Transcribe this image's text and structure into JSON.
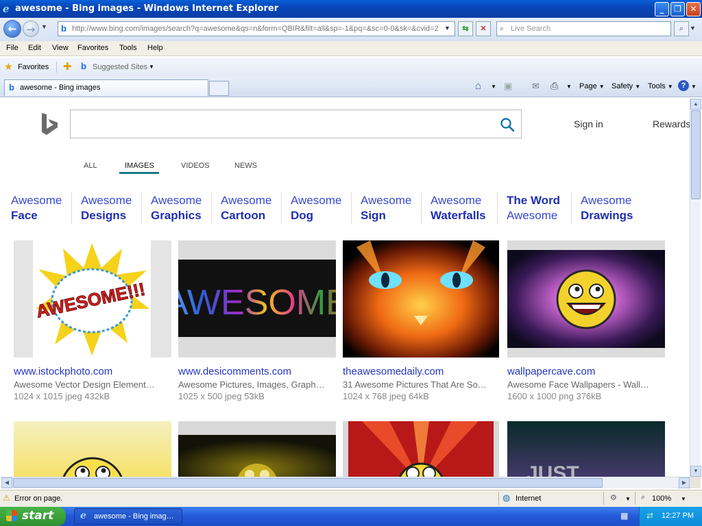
{
  "window": {
    "title": "awesome - Bing images - Windows Internet Explorer",
    "minimize": "_",
    "maximize": "❐",
    "close": "✕"
  },
  "address_bar": {
    "url": "http://www.bing.com/images/search?q=awesome&qs=n&form=QBIR&filt=all&sp=-1&pq=&sc=0-0&sk=&cvid=2",
    "search_placeholder": "Live Search"
  },
  "menu": [
    "File",
    "Edit",
    "View",
    "Favorites",
    "Tools",
    "Help"
  ],
  "favorites_bar": {
    "favorites": "Favorites",
    "suggested": "Suggested Sites"
  },
  "tabs": {
    "active": "awesome - Bing images"
  },
  "command_bar": {
    "page": "Page",
    "safety": "Safety",
    "tools": "Tools"
  },
  "bing": {
    "sign_in": "Sign in",
    "rewards": "Rewards",
    "nav": [
      "ALL",
      "IMAGES",
      "VIDEOS",
      "NEWS"
    ],
    "active_nav": "IMAGES",
    "related": [
      {
        "top": "Awesome",
        "bottom": "Face"
      },
      {
        "top": "Awesome",
        "bottom": "Designs"
      },
      {
        "top": "Awesome",
        "bottom": "Graphics"
      },
      {
        "top": "Awesome",
        "bottom": "Cartoon"
      },
      {
        "top": "Awesome",
        "bottom": "Dog"
      },
      {
        "top": "Awesome",
        "bottom": "Sign"
      },
      {
        "top": "Awesome",
        "bottom": "Waterfalls"
      },
      {
        "top": "The Word",
        "bottom": "Awesome"
      },
      {
        "top": "Awesome",
        "bottom": "Drawings"
      }
    ],
    "results": [
      {
        "site": "www.istockphoto.com",
        "desc": "Awesome Vector Design Element…",
        "meta": "1024 x 1015 jpeg 432kB",
        "thumb_text": "AWESOME!!!"
      },
      {
        "site": "www.desicomments.com",
        "desc": "Awesome Pictures, Images, Graph…",
        "meta": "1025 x 500 jpeg 53kB",
        "thumb_text": "AWESOME"
      },
      {
        "site": "theawesomedaily.com",
        "desc": "31 Awesome Pictures That Are So…",
        "meta": "1024 x 768 jpeg 64kB"
      },
      {
        "site": "wallpapercave.com",
        "desc": "Awesome Face Wallpapers - Wall…",
        "meta": "1600 x 1000 png 376kB"
      }
    ],
    "row2_text": "JUST"
  },
  "status": {
    "message": "Error on page.",
    "zone": "Internet",
    "zoom": "100%"
  },
  "taskbar": {
    "start": "start",
    "task": "awesome - Bing imag…",
    "clock": "12:27 PM"
  }
}
